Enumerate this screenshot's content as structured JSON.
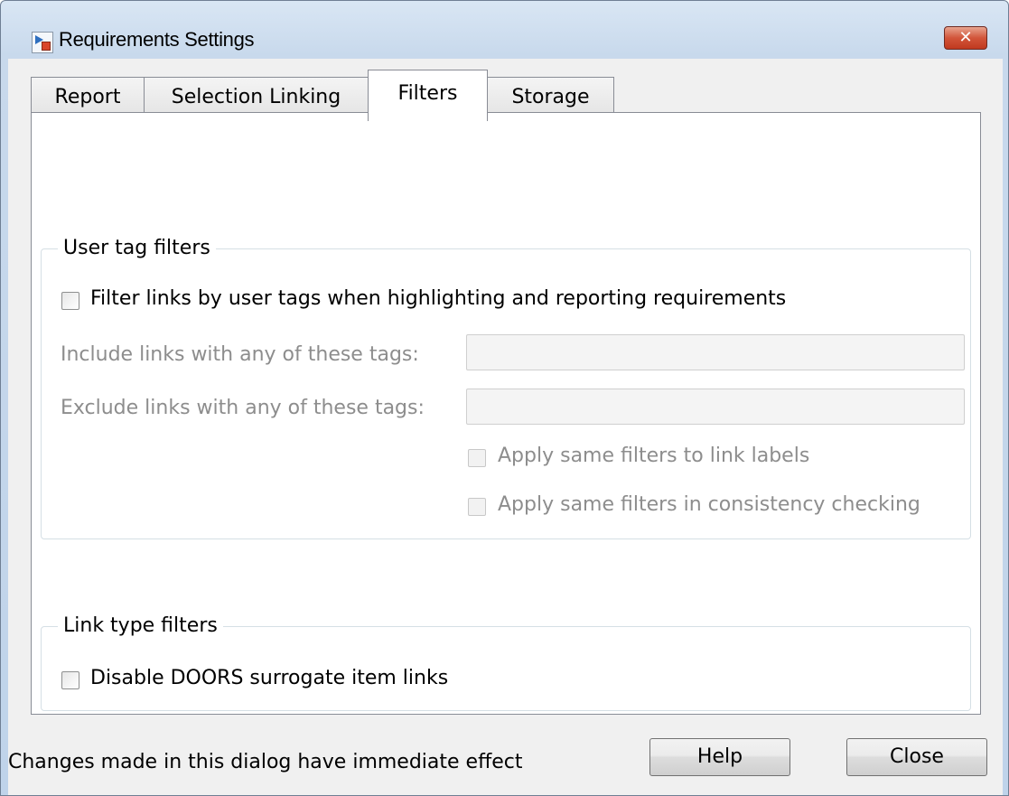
{
  "window": {
    "title": "Requirements Settings",
    "close_glyph": "✕"
  },
  "tabs": [
    {
      "label": "Report",
      "active": false
    },
    {
      "label": "Selection Linking",
      "active": false
    },
    {
      "label": "Filters",
      "active": true
    },
    {
      "label": "Storage",
      "active": false
    }
  ],
  "user_tag_filters": {
    "legend": "User tag filters",
    "filter_checkbox": {
      "label": "Filter links by user tags when highlighting and reporting requirements",
      "checked": false
    },
    "include_label": "Include links with any of these tags:",
    "include_value": "",
    "exclude_label": "Exclude links with any of these tags:",
    "exclude_value": "",
    "apply_labels": {
      "label": "Apply same filters to link labels",
      "checked": false,
      "enabled": false
    },
    "apply_consistency": {
      "label": "Apply same filters in consistency checking",
      "checked": false,
      "enabled": false
    }
  },
  "link_type_filters": {
    "legend": "Link type filters",
    "doors_checkbox": {
      "label": "Disable DOORS surrogate item links",
      "checked": false
    }
  },
  "footer": {
    "message": "Changes made in this dialog have immediate effect",
    "help_label": "Help",
    "close_label": "Close"
  },
  "icons": {
    "app": "simulink-requirements-icon",
    "close": "close-icon"
  }
}
